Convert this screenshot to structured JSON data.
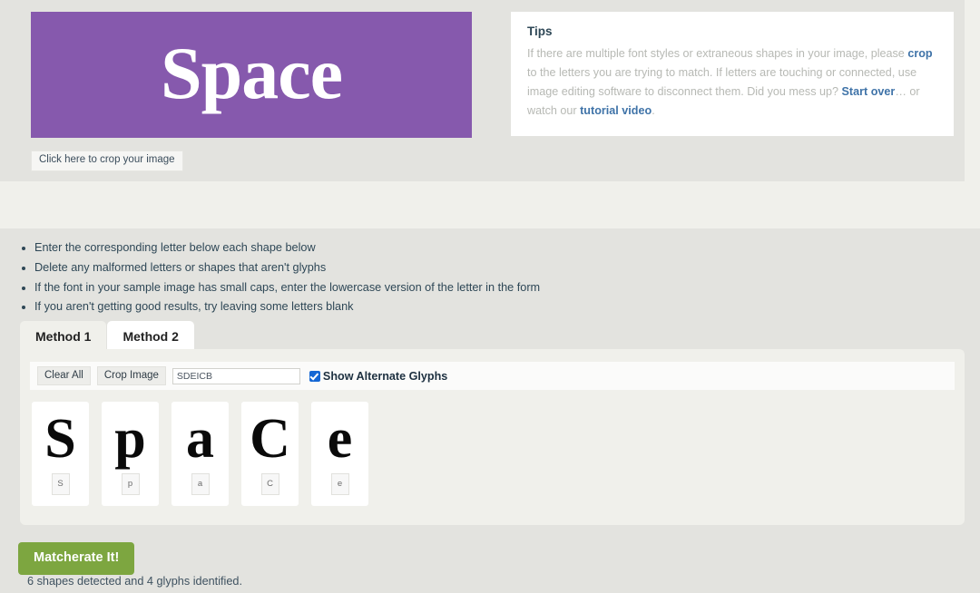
{
  "preview": {
    "word": "Space",
    "bg_color": "#8659ad",
    "text_color": "#ffffff",
    "crop_button_label": "Click here to crop your image"
  },
  "tips": {
    "title": "Tips",
    "part1": "If there are multiple font styles or extraneous shapes in your image, please ",
    "link_crop": "crop",
    "part2": " to the letters you are trying to match. If letters are touching or connected, use image editing software to disconnect them. Did you mess up? ",
    "link_start_over": "Start over",
    "part3": "… or watch our ",
    "link_tutorial": "tutorial video",
    "part4": "."
  },
  "hints": [
    "Enter the corresponding letter below each shape below",
    "Delete any malformed letters or shapes that aren't glyphs",
    "If the font in your sample image has small caps, enter the lowercase version of the letter in the form",
    "If you aren't getting good results, try leaving some letters blank"
  ],
  "tabs": [
    {
      "label": "Method 1",
      "active": true
    },
    {
      "label": "Method 2",
      "active": false
    }
  ],
  "toolbar": {
    "clear_all_label": "Clear All",
    "crop_image_label": "Crop Image",
    "text_input_value": "SDEICB",
    "text_input_placeholder": "",
    "show_alternate_glyphs_label": "Show Alternate Glyphs",
    "show_alternate_glyphs_checked": true,
    "checkbox_color": "#1467d4"
  },
  "glyphs": [
    {
      "shape": "S",
      "letter": "S"
    },
    {
      "shape": "p",
      "letter": "p"
    },
    {
      "shape": "a",
      "letter": "a"
    },
    {
      "shape": "C",
      "letter": "C"
    },
    {
      "shape": "e",
      "letter": "e"
    }
  ],
  "footer": {
    "submit_label": "Matcherate It!",
    "submit_color": "#7da640",
    "status": "6 shapes detected and 4 glyphs identified."
  }
}
